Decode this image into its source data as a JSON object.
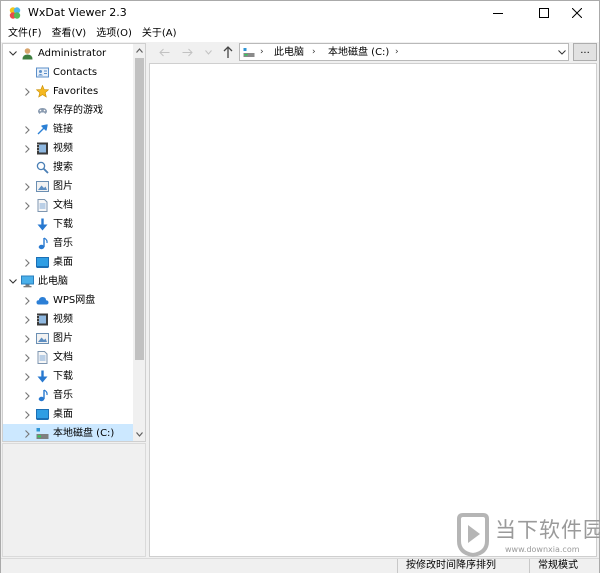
{
  "window": {
    "title": "WxDat Viewer 2.3"
  },
  "menu": [
    "文件(F)",
    "查看(V)",
    "选项(O)",
    "关于(A)"
  ],
  "tree": [
    {
      "label": "Administrator",
      "icon": "user-icon",
      "expander": "expanded",
      "level": 0
    },
    {
      "label": "Contacts",
      "icon": "contacts-icon",
      "expander": "none",
      "level": 1
    },
    {
      "label": "Favorites",
      "icon": "star-icon",
      "expander": "collapsed",
      "level": 1
    },
    {
      "label": "保存的游戏",
      "icon": "saved-games-icon",
      "expander": "none",
      "level": 1
    },
    {
      "label": "链接",
      "icon": "link-icon",
      "expander": "collapsed",
      "level": 1
    },
    {
      "label": "视频",
      "icon": "video-icon",
      "expander": "collapsed",
      "level": 1
    },
    {
      "label": "搜索",
      "icon": "search-icon",
      "expander": "none",
      "level": 1
    },
    {
      "label": "图片",
      "icon": "pictures-icon",
      "expander": "collapsed",
      "level": 1
    },
    {
      "label": "文档",
      "icon": "documents-icon",
      "expander": "collapsed",
      "level": 1
    },
    {
      "label": "下载",
      "icon": "download-icon",
      "expander": "none",
      "level": 1
    },
    {
      "label": "音乐",
      "icon": "music-icon",
      "expander": "none",
      "level": 1
    },
    {
      "label": "桌面",
      "icon": "desktop-icon",
      "expander": "collapsed",
      "level": 1
    },
    {
      "label": "此电脑",
      "icon": "computer-icon",
      "expander": "expanded",
      "level": 0
    },
    {
      "label": "WPS网盘",
      "icon": "cloud-icon",
      "expander": "collapsed",
      "level": 1
    },
    {
      "label": "视频",
      "icon": "video-icon",
      "expander": "collapsed",
      "level": 1
    },
    {
      "label": "图片",
      "icon": "pictures-icon",
      "expander": "collapsed",
      "level": 1
    },
    {
      "label": "文档",
      "icon": "documents-icon",
      "expander": "collapsed",
      "level": 1
    },
    {
      "label": "下载",
      "icon": "download-icon",
      "expander": "collapsed",
      "level": 1
    },
    {
      "label": "音乐",
      "icon": "music-icon",
      "expander": "collapsed",
      "level": 1
    },
    {
      "label": "桌面",
      "icon": "desktop-icon",
      "expander": "collapsed",
      "level": 1
    },
    {
      "label": "本地磁盘 (C:)",
      "icon": "drive-icon",
      "expander": "collapsed",
      "level": 1,
      "selected": true
    }
  ],
  "address": {
    "segments": [
      "此电脑",
      "本地磁盘 (C:)"
    ],
    "browse_label": "..."
  },
  "status": {
    "sort": "按修改时间降序排列",
    "mode": "常规模式"
  },
  "watermark": {
    "text": "当下软件园",
    "url": "www.downxia.com"
  },
  "colors": {
    "selection": "#cce8ff",
    "accent": "#0078d7"
  }
}
